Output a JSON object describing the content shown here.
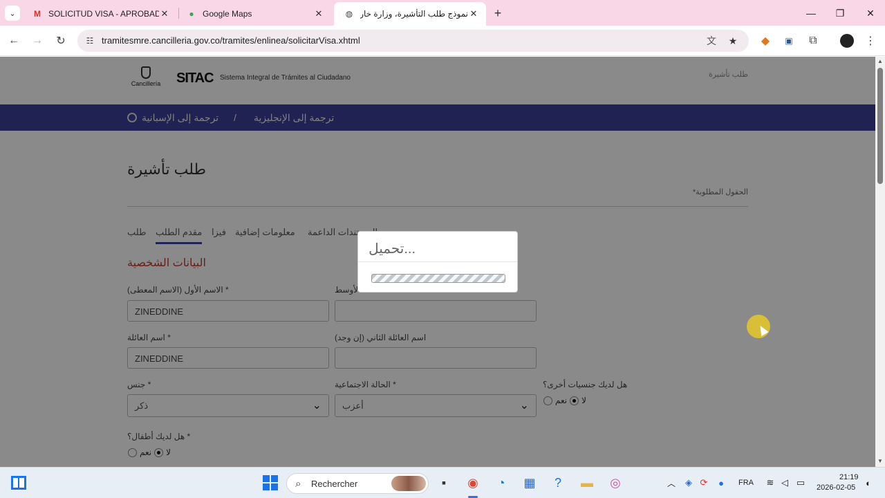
{
  "browser": {
    "tabs": [
      {
        "title": "SOLICITUD VISA - APROBADA -",
        "favicon": "gmail-icon"
      },
      {
        "title": "Google Maps",
        "favicon": "maps-pin-icon"
      },
      {
        "title": "نموذج طلب التأشيرة، وزارة خارجية",
        "favicon": "globe-icon",
        "active": true
      }
    ],
    "url": "tramitesmre.cancilleria.gov.co/tramites/enlinea/solicitarVisa.xhtml"
  },
  "site": {
    "crest_text": "Cancillería",
    "brand": "SITAC",
    "brand_sub": "Sistema Integral de Trámites al Ciudadano",
    "header_link": "طلب تأشيرة",
    "nav": {
      "to_spanish": "ترجمة إلى الإسبانية",
      "separator": "/",
      "to_english": "ترجمة إلى الإنجليزية"
    }
  },
  "form": {
    "page_title": "طلب تأشيرة",
    "required_note": "*الحقول المطلوبة",
    "steps": [
      "طلب",
      "مقدم الطلب",
      "فيزا",
      "معلومات إضافية",
      "المستندات الداعمة"
    ],
    "active_step": "مقدم الطلب",
    "section_title": "البيانات الشخصية",
    "first_name_label": "الاسم الأول (الاسم المعطى) *",
    "first_name_value": "ZINEDDINE",
    "middle_name_label": "الأوسط",
    "surname_label": "اسم العائلة *",
    "surname_value": "ZINEDDINE",
    "second_surname_label": "اسم العائلة الثاني (إن وجد)",
    "gender_label": "جنس *",
    "gender_value": "ذكر",
    "marital_label": "الحالة الاجتماعية *",
    "marital_value": "أعزب",
    "other_nationality_label": "هل لديك جنسيات أخرى؟",
    "children_label": "هل لديك أطفال؟ *",
    "yes": "نعم",
    "no": "لا"
  },
  "modal": {
    "title": "تحميل..."
  },
  "taskbar": {
    "search_placeholder": "Rechercher",
    "language": "FRA",
    "time": "21:19",
    "date": "2026-02-05"
  },
  "colors": {
    "navbar": "#3a3f9a",
    "section_title": "#c0392b",
    "tabstrip": "#f9d7e6"
  }
}
